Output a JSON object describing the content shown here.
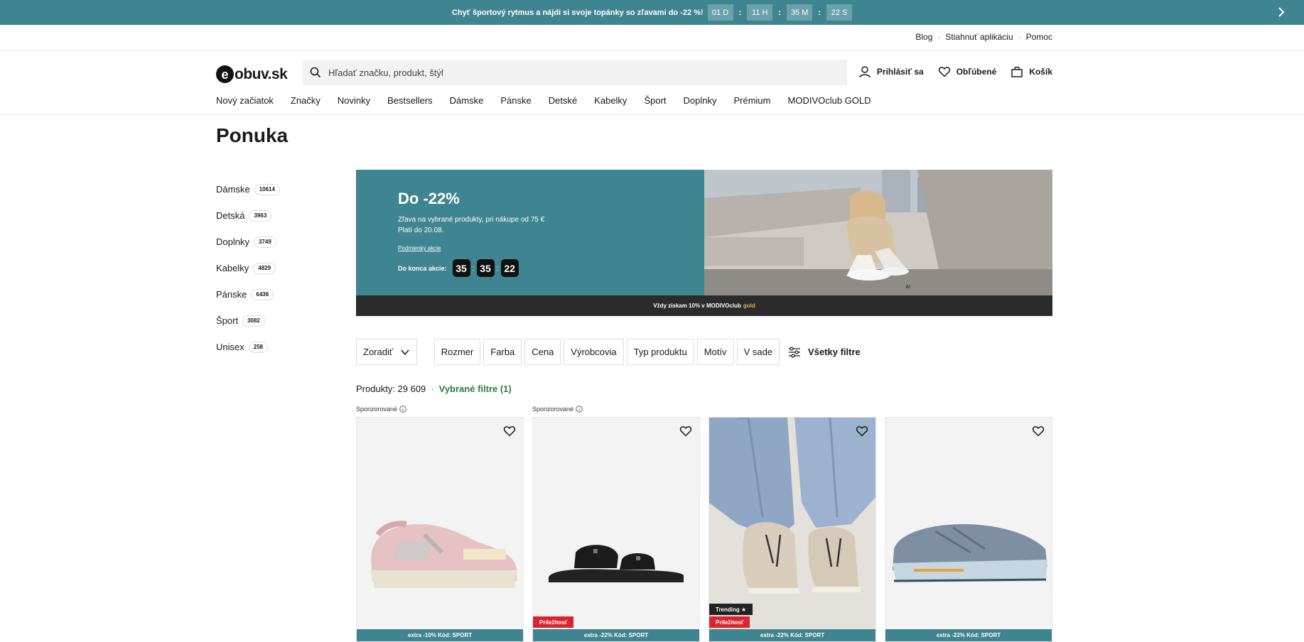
{
  "promo_bar": {
    "text": "Chyť športový rytmus a nájdi si svoje topánky so zľavami do -22 %!",
    "countdown": [
      "01 D",
      "11 H",
      "35 M",
      "22 S"
    ]
  },
  "utility": {
    "links": [
      "Blog",
      "Stiahnuť aplikáciu",
      "Pomoc"
    ]
  },
  "header": {
    "logo_e": "e",
    "logo_text": "obuv.sk",
    "search_placeholder": "Hľadať značku, produkt, štýl",
    "login": "Prihlásiť sa",
    "favorites": "Obľúbené",
    "cart": "Košík"
  },
  "nav": [
    "Nový začiatok",
    "Značky",
    "Novinky",
    "Bestsellers",
    "Dámske",
    "Pánske",
    "Detské",
    "Kabelky",
    "Šport",
    "Doplnky",
    "Prémium",
    "MODIVOclub GOLD"
  ],
  "page_title": "Ponuka",
  "sidebar": [
    {
      "label": "Dámske",
      "count": "10614"
    },
    {
      "label": "Detská",
      "count": "3963"
    },
    {
      "label": "Doplnky",
      "count": "3749"
    },
    {
      "label": "Kabelky",
      "count": "4829"
    },
    {
      "label": "Pánske",
      "count": "6436"
    },
    {
      "label": "Šport",
      "count": "3082"
    },
    {
      "label": "Unisex",
      "count": "258"
    }
  ],
  "banner": {
    "title": "Do -22%",
    "desc1": "Zľava na vybrané produkty, pri nákupe od 75 €",
    "desc2": "Platí do 20.08.",
    "terms": "Podmienky akcie",
    "countdown_label": "Do konca akcie:",
    "countdown": [
      "35",
      "35",
      "22"
    ],
    "strip_text": "Vždy získam 10% v MODIVOclub",
    "strip_gold": "gold",
    "ai_badge": "AI"
  },
  "filters": {
    "sort": "Zoradiť",
    "items": [
      "Rozmer",
      "Farba",
      "Cena",
      "Výrobcovia",
      "Typ produktu",
      "Motív",
      "V sade"
    ],
    "all": "Všetky filtre"
  },
  "products_count": "Produkty: 29 609",
  "selected_filters": "Vybrané filtre (1)",
  "sponsored_label": "Sponzorované",
  "products": [
    {
      "promo": "extra -10% Kód: SPORT",
      "sponsored": true
    },
    {
      "promo": "extra -22% Kód: SPORT",
      "sponsored": true,
      "tag_red": "Príležitosť"
    },
    {
      "promo": "extra -22% Kód: SPORT",
      "tag_red": "Príležitosť",
      "tag_dark": "Trending ★"
    },
    {
      "promo": "extra -22% Kód: SPORT"
    }
  ],
  "colors": {
    "teal": "#3f8591",
    "promo_red": "#d9252b",
    "green_link": "#2e7d3a"
  }
}
